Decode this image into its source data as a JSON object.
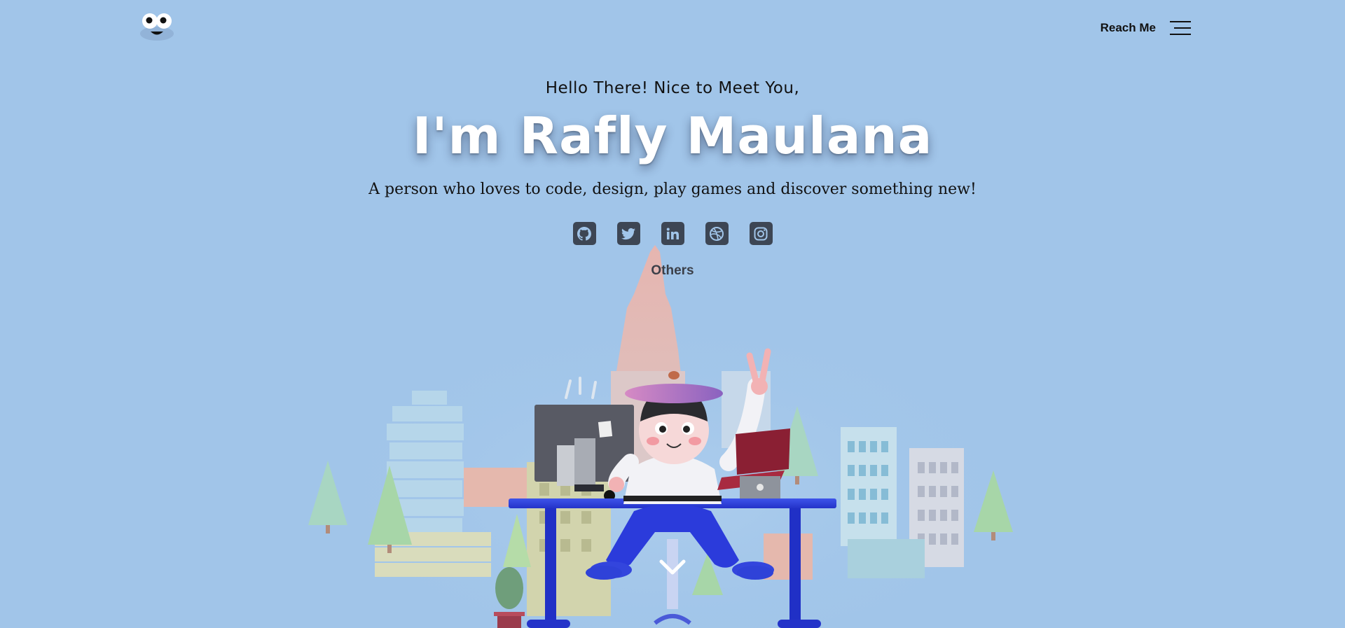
{
  "header": {
    "logo_icon": "cartoon-eyes-face-icon",
    "reach_me_label": "Reach Me",
    "menu_icon": "hamburger-menu-icon"
  },
  "hero": {
    "greeting": "Hello There! Nice to Meet You,",
    "title": "I'm Rafly Maulana",
    "tagline": "A person who loves to code, design, play games and discover something new!",
    "others_label": "Others"
  },
  "socials": [
    {
      "icon": "github-icon"
    },
    {
      "icon": "twitter-icon"
    },
    {
      "icon": "linkedin-icon"
    },
    {
      "icon": "dribbble-icon"
    },
    {
      "icon": "instagram-icon"
    }
  ],
  "scene": {
    "illustration": "3d-character-at-desk-with-city-background",
    "scroll_icon": "chevron-down-icon"
  },
  "colors": {
    "background": "#a1c5e9",
    "title_text": "#ffffff",
    "social_button": "#3d4654",
    "desk_blue": "#2233cc"
  }
}
